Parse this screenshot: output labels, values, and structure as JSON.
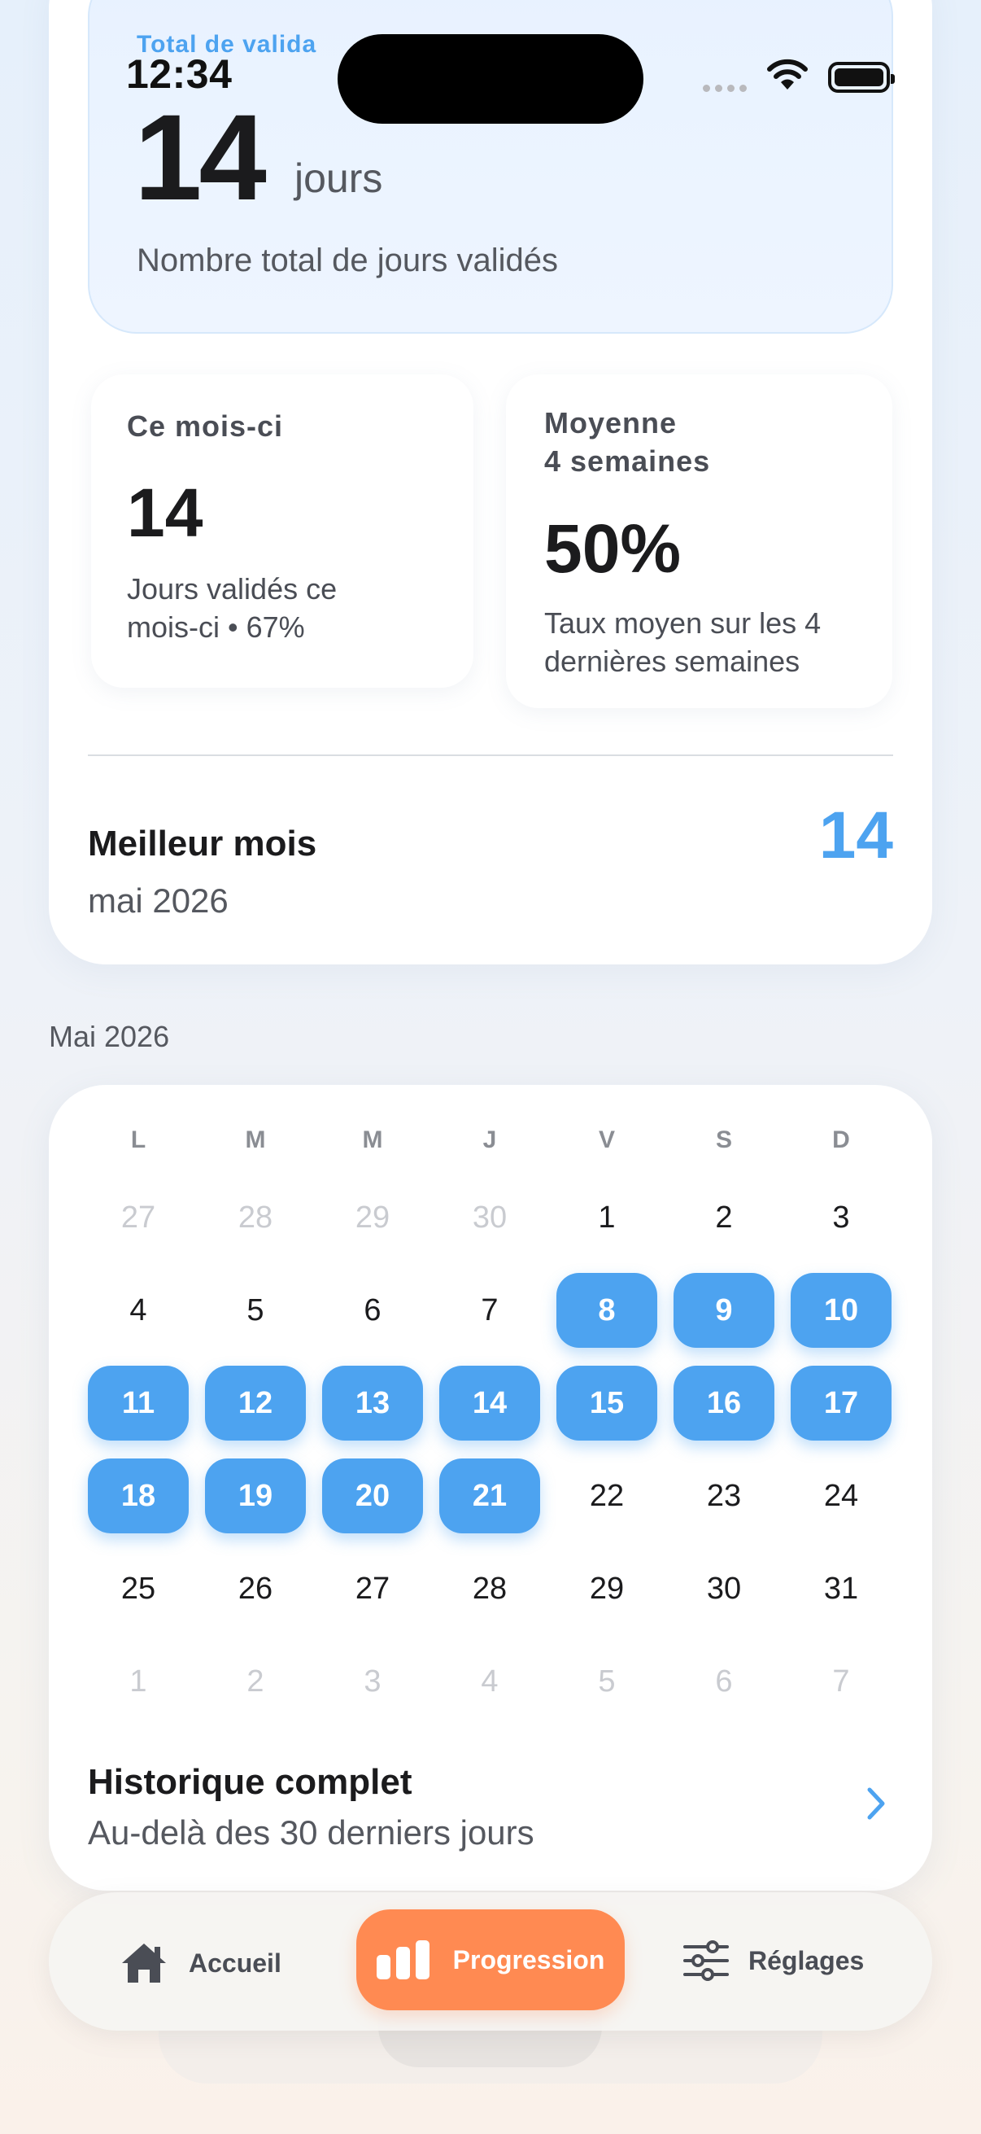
{
  "status_bar": {
    "time": "12:34"
  },
  "total": {
    "label": "Total de valida",
    "value": "14",
    "unit": "jours",
    "description": "Nombre total de jours validés"
  },
  "stats": {
    "month": {
      "title": "Ce mois-ci",
      "value": "14",
      "desc_line1": "Jours validés ce",
      "desc_line2": "mois-ci • 67%"
    },
    "average": {
      "title_line1": "Moyenne",
      "title_line2": "4 semaines",
      "value": "50%",
      "desc_line1": "Taux moyen sur les 4",
      "desc_line2": "dernières semaines"
    }
  },
  "best_month": {
    "title": "Meilleur mois",
    "month": "mai 2026",
    "value": "14"
  },
  "calendar": {
    "month_label": "Mai 2026",
    "weekdays": [
      "L",
      "M",
      "M",
      "J",
      "V",
      "S",
      "D"
    ],
    "weeks": [
      [
        {
          "d": "27",
          "t": "other"
        },
        {
          "d": "28",
          "t": "other"
        },
        {
          "d": "29",
          "t": "other"
        },
        {
          "d": "30",
          "t": "other"
        },
        {
          "d": "1",
          "t": "normal"
        },
        {
          "d": "2",
          "t": "normal"
        },
        {
          "d": "3",
          "t": "normal"
        }
      ],
      [
        {
          "d": "4",
          "t": "normal"
        },
        {
          "d": "5",
          "t": "normal"
        },
        {
          "d": "6",
          "t": "normal"
        },
        {
          "d": "7",
          "t": "normal"
        },
        {
          "d": "8",
          "t": "valid"
        },
        {
          "d": "9",
          "t": "valid"
        },
        {
          "d": "10",
          "t": "valid"
        }
      ],
      [
        {
          "d": "11",
          "t": "valid"
        },
        {
          "d": "12",
          "t": "valid"
        },
        {
          "d": "13",
          "t": "valid"
        },
        {
          "d": "14",
          "t": "valid"
        },
        {
          "d": "15",
          "t": "valid"
        },
        {
          "d": "16",
          "t": "valid"
        },
        {
          "d": "17",
          "t": "valid"
        }
      ],
      [
        {
          "d": "18",
          "t": "valid"
        },
        {
          "d": "19",
          "t": "valid"
        },
        {
          "d": "20",
          "t": "valid"
        },
        {
          "d": "21",
          "t": "valid"
        },
        {
          "d": "22",
          "t": "normal"
        },
        {
          "d": "23",
          "t": "normal"
        },
        {
          "d": "24",
          "t": "normal"
        }
      ],
      [
        {
          "d": "25",
          "t": "normal"
        },
        {
          "d": "26",
          "t": "normal"
        },
        {
          "d": "27",
          "t": "normal"
        },
        {
          "d": "28",
          "t": "normal"
        },
        {
          "d": "29",
          "t": "normal"
        },
        {
          "d": "30",
          "t": "normal"
        },
        {
          "d": "31",
          "t": "normal"
        }
      ],
      [
        {
          "d": "1",
          "t": "other"
        },
        {
          "d": "2",
          "t": "other"
        },
        {
          "d": "3",
          "t": "other"
        },
        {
          "d": "4",
          "t": "other"
        },
        {
          "d": "5",
          "t": "other"
        },
        {
          "d": "6",
          "t": "other"
        },
        {
          "d": "7",
          "t": "other"
        }
      ]
    ]
  },
  "history": {
    "title": "Historique complet",
    "subtitle": "Au-delà des 30 derniers jours"
  },
  "tabbar": {
    "home": {
      "label": "Accueil",
      "icon": "house-icon"
    },
    "progress": {
      "label": "Progression",
      "icon": "bar-chart-icon",
      "active": true
    },
    "settings": {
      "label": "Réglages",
      "icon": "sliders-icon"
    }
  },
  "colors": {
    "accent_blue": "#4DA3F0",
    "accent_orange": "#FF8A52"
  }
}
